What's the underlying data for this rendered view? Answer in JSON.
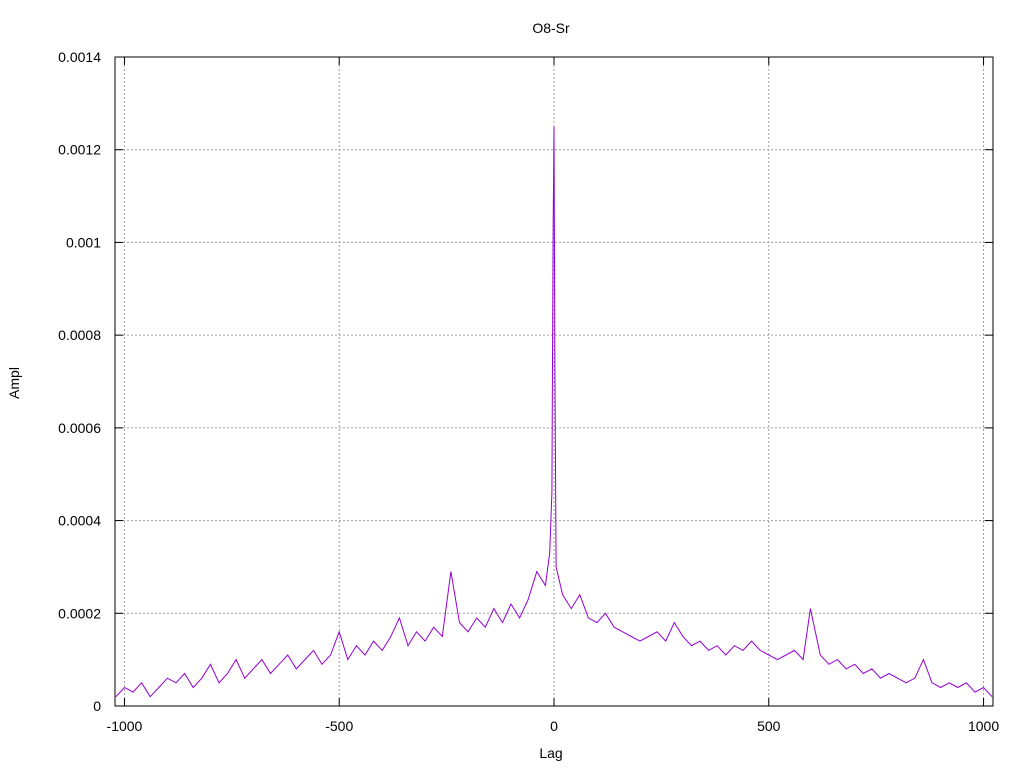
{
  "chart_data": {
    "type": "line",
    "title": "O8-Sr",
    "xlabel": "Lag",
    "ylabel": "Ampl",
    "xlim": [
      -1022,
      1022
    ],
    "ylim": [
      0,
      0.0014
    ],
    "x_ticks": [
      -1000,
      -500,
      0,
      500,
      1000
    ],
    "x_tick_labels": [
      "-1000",
      "-500",
      "0",
      "500",
      "1000"
    ],
    "y_ticks": [
      0,
      0.0002,
      0.0004,
      0.0006,
      0.0008,
      0.001,
      0.0012,
      0.0014
    ],
    "y_tick_labels": [
      "0",
      "0.0002",
      "0.0004",
      "0.0006",
      "0.0008",
      "0.001",
      "0.0012",
      "0.0014"
    ],
    "grid": true,
    "legend": "none",
    "series": [
      {
        "color": "#9400d3",
        "points": [
          [
            -1020,
            2e-05
          ],
          [
            -1000,
            4e-05
          ],
          [
            -980,
            3e-05
          ],
          [
            -960,
            5e-05
          ],
          [
            -940,
            2e-05
          ],
          [
            -920,
            4e-05
          ],
          [
            -900,
            6e-05
          ],
          [
            -880,
            5e-05
          ],
          [
            -860,
            7e-05
          ],
          [
            -840,
            4e-05
          ],
          [
            -820,
            6e-05
          ],
          [
            -800,
            9e-05
          ],
          [
            -780,
            5e-05
          ],
          [
            -760,
            7e-05
          ],
          [
            -740,
            0.0001
          ],
          [
            -720,
            6e-05
          ],
          [
            -700,
            8e-05
          ],
          [
            -680,
            0.0001
          ],
          [
            -660,
            7e-05
          ],
          [
            -640,
            9e-05
          ],
          [
            -620,
            0.00011
          ],
          [
            -600,
            8e-05
          ],
          [
            -580,
            0.0001
          ],
          [
            -560,
            0.00012
          ],
          [
            -540,
            9e-05
          ],
          [
            -520,
            0.00011
          ],
          [
            -500,
            0.00016
          ],
          [
            -480,
            0.0001
          ],
          [
            -460,
            0.00013
          ],
          [
            -440,
            0.00011
          ],
          [
            -420,
            0.00014
          ],
          [
            -400,
            0.00012
          ],
          [
            -380,
            0.00015
          ],
          [
            -360,
            0.00019
          ],
          [
            -340,
            0.00013
          ],
          [
            -320,
            0.00016
          ],
          [
            -300,
            0.00014
          ],
          [
            -280,
            0.00017
          ],
          [
            -260,
            0.00015
          ],
          [
            -240,
            0.00029
          ],
          [
            -220,
            0.00018
          ],
          [
            -200,
            0.00016
          ],
          [
            -180,
            0.00019
          ],
          [
            -160,
            0.00017
          ],
          [
            -140,
            0.00021
          ],
          [
            -120,
            0.00018
          ],
          [
            -100,
            0.00022
          ],
          [
            -80,
            0.00019
          ],
          [
            -60,
            0.00023
          ],
          [
            -40,
            0.00029
          ],
          [
            -20,
            0.00026
          ],
          [
            -10,
            0.00033
          ],
          [
            -5,
            0.00046
          ],
          [
            -2,
            0.00102
          ],
          [
            0,
            0.00125
          ],
          [
            2,
            0.00073
          ],
          [
            5,
            0.0003
          ],
          [
            10,
            0.00028
          ],
          [
            20,
            0.00024
          ],
          [
            40,
            0.00021
          ],
          [
            60,
            0.00024
          ],
          [
            80,
            0.00019
          ],
          [
            100,
            0.00018
          ],
          [
            120,
            0.0002
          ],
          [
            140,
            0.00017
          ],
          [
            160,
            0.00016
          ],
          [
            180,
            0.00015
          ],
          [
            200,
            0.00014
          ],
          [
            220,
            0.00015
          ],
          [
            240,
            0.00016
          ],
          [
            260,
            0.00014
          ],
          [
            280,
            0.00018
          ],
          [
            300,
            0.00015
          ],
          [
            320,
            0.00013
          ],
          [
            340,
            0.00014
          ],
          [
            360,
            0.00012
          ],
          [
            380,
            0.00013
          ],
          [
            400,
            0.00011
          ],
          [
            420,
            0.00013
          ],
          [
            440,
            0.00012
          ],
          [
            460,
            0.00014
          ],
          [
            480,
            0.00012
          ],
          [
            500,
            0.00011
          ],
          [
            520,
            0.0001
          ],
          [
            540,
            0.00011
          ],
          [
            560,
            0.00012
          ],
          [
            580,
            0.0001
          ],
          [
            597,
            0.00021
          ],
          [
            620,
            0.00011
          ],
          [
            640,
            9e-05
          ],
          [
            660,
            0.0001
          ],
          [
            680,
            8e-05
          ],
          [
            700,
            9e-05
          ],
          [
            720,
            7e-05
          ],
          [
            740,
            8e-05
          ],
          [
            760,
            6e-05
          ],
          [
            780,
            7e-05
          ],
          [
            800,
            6e-05
          ],
          [
            820,
            5e-05
          ],
          [
            840,
            6e-05
          ],
          [
            860,
            0.0001
          ],
          [
            880,
            5e-05
          ],
          [
            900,
            4e-05
          ],
          [
            920,
            5e-05
          ],
          [
            940,
            4e-05
          ],
          [
            960,
            5e-05
          ],
          [
            980,
            3e-05
          ],
          [
            1000,
            4e-05
          ],
          [
            1020,
            2e-05
          ]
        ]
      }
    ]
  }
}
